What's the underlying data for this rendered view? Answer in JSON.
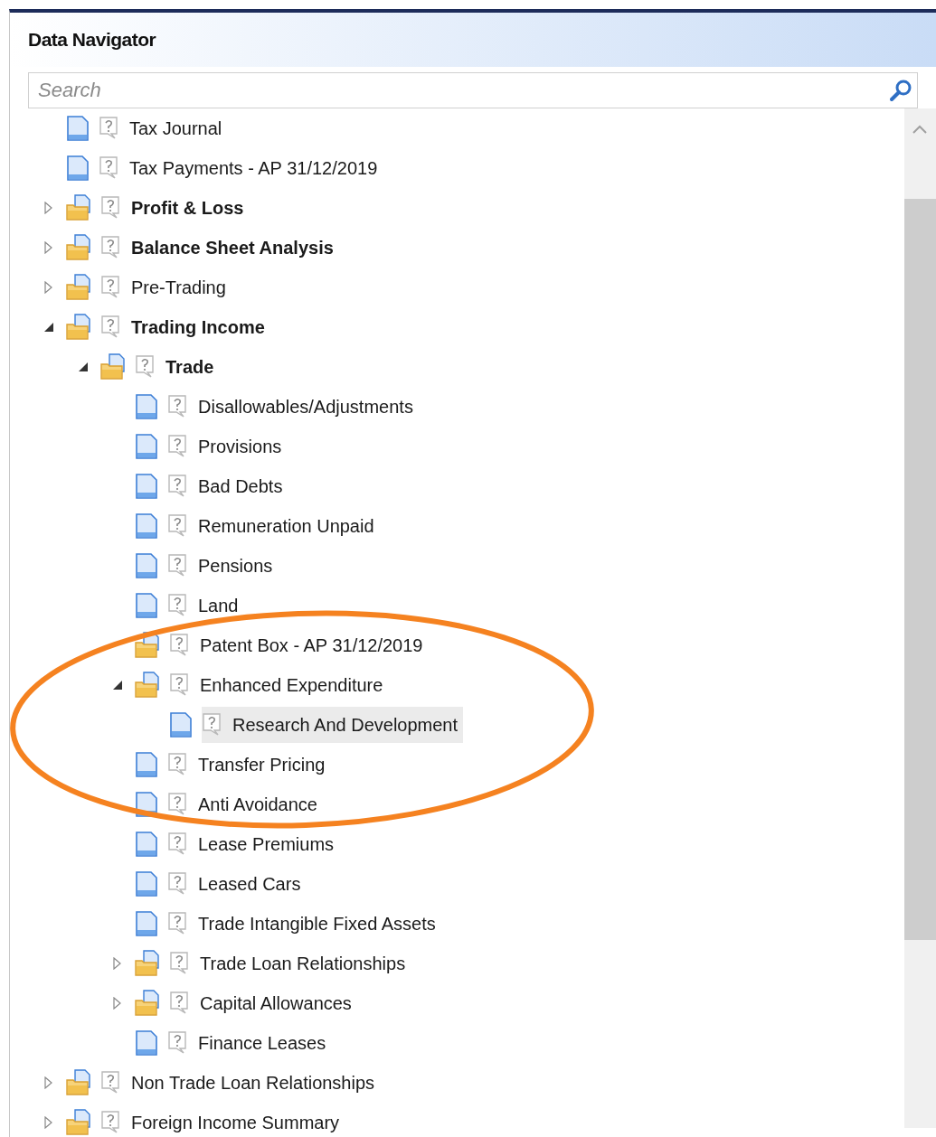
{
  "panel": {
    "title": "Data Navigator"
  },
  "search": {
    "placeholder": "Search"
  },
  "tree": [
    {
      "label": "Tax Journal",
      "kind": "document",
      "bold": false,
      "selected": false
    },
    {
      "label": "Tax Payments - AP 31/12/2019",
      "kind": "document",
      "bold": false,
      "selected": false
    },
    {
      "label": "Profit & Loss",
      "kind": "folder",
      "expanded": false,
      "bold": true,
      "selected": false
    },
    {
      "label": "Balance Sheet Analysis",
      "kind": "folder",
      "expanded": false,
      "bold": true,
      "selected": false
    },
    {
      "label": "Pre-Trading",
      "kind": "folder",
      "expanded": false,
      "bold": false,
      "selected": false
    },
    {
      "label": "Trading Income",
      "kind": "folder",
      "expanded": true,
      "bold": true,
      "selected": false,
      "children": [
        {
          "label": "Trade",
          "kind": "folder",
          "expanded": true,
          "bold": true,
          "selected": false,
          "children": [
            {
              "label": "Disallowables/Adjustments",
              "kind": "document",
              "bold": false,
              "selected": false
            },
            {
              "label": "Provisions",
              "kind": "document",
              "bold": false,
              "selected": false
            },
            {
              "label": "Bad Debts",
              "kind": "document",
              "bold": false,
              "selected": false
            },
            {
              "label": "Remuneration Unpaid",
              "kind": "document",
              "bold": false,
              "selected": false
            },
            {
              "label": "Pensions",
              "kind": "document",
              "bold": false,
              "selected": false
            },
            {
              "label": "Land",
              "kind": "document",
              "bold": false,
              "selected": false
            },
            {
              "label": "Patent Box - AP 31/12/2019",
              "kind": "folder",
              "bold": false,
              "selected": false
            },
            {
              "label": "Enhanced Expenditure",
              "kind": "folder",
              "expanded": true,
              "bold": false,
              "selected": false,
              "children": [
                {
                  "label": "Research And Development",
                  "kind": "document",
                  "bold": false,
                  "selected": true
                }
              ]
            },
            {
              "label": "Transfer Pricing",
              "kind": "document",
              "bold": false,
              "selected": false
            },
            {
              "label": "Anti Avoidance",
              "kind": "document",
              "bold": false,
              "selected": false
            },
            {
              "label": "Lease Premiums",
              "kind": "document",
              "bold": false,
              "selected": false
            },
            {
              "label": "Leased Cars",
              "kind": "document",
              "bold": false,
              "selected": false
            },
            {
              "label": "Trade Intangible Fixed Assets",
              "kind": "document",
              "bold": false,
              "selected": false
            },
            {
              "label": "Trade Loan Relationships",
              "kind": "folder",
              "expanded": false,
              "bold": false,
              "selected": false
            },
            {
              "label": "Capital Allowances",
              "kind": "folder",
              "expanded": false,
              "bold": false,
              "selected": false
            },
            {
              "label": "Finance Leases",
              "kind": "document",
              "bold": false,
              "selected": false
            }
          ]
        }
      ]
    },
    {
      "label": "Non Trade Loan Relationships",
      "kind": "folder",
      "expanded": false,
      "bold": false,
      "selected": false
    },
    {
      "label": "Foreign Income Summary",
      "kind": "folder",
      "expanded": false,
      "bold": false,
      "selected": false
    }
  ],
  "annotation": {
    "kind": "ellipse"
  }
}
